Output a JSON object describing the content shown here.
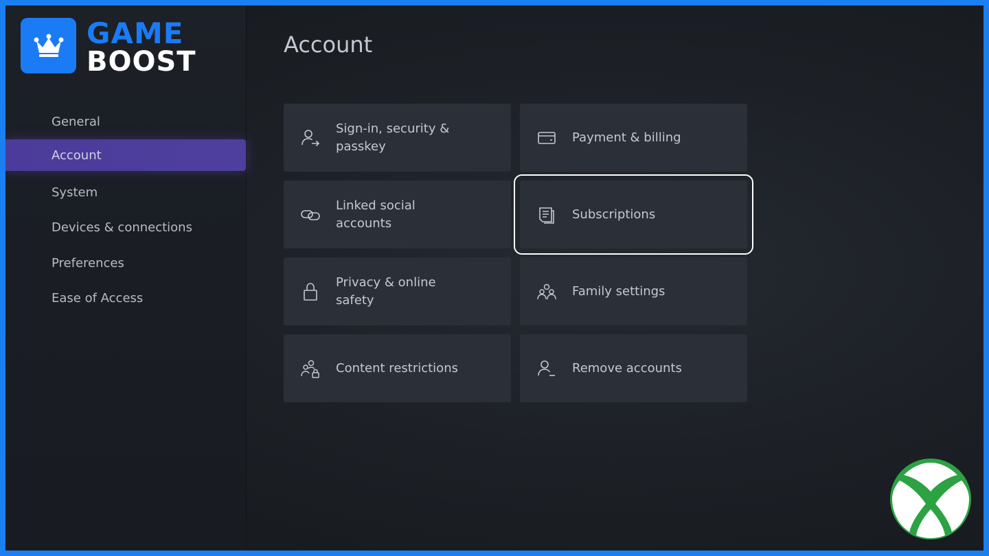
{
  "brand": {
    "logo_word1": "GAME",
    "logo_word2": "BOOST",
    "accent_color": "#1b7bf5"
  },
  "sidebar": {
    "items": [
      {
        "label": "General",
        "active": false
      },
      {
        "label": "Account",
        "active": true
      },
      {
        "label": "System",
        "active": false
      },
      {
        "label": "Devices & connections",
        "active": false
      },
      {
        "label": "Preferences",
        "active": false
      },
      {
        "label": "Ease of Access",
        "active": false
      }
    ],
    "active_color": "#4c3b9a"
  },
  "main": {
    "title": "Account",
    "tiles": [
      {
        "label": "Sign-in, security & passkey",
        "icon": "person-arrow-icon"
      },
      {
        "label": "Payment & billing",
        "icon": "credit-card-icon"
      },
      {
        "label": "Linked social accounts",
        "icon": "link-icon"
      },
      {
        "label": "Subscriptions",
        "icon": "document-list-icon",
        "focused": true
      },
      {
        "label": "Privacy & online safety",
        "icon": "lock-icon"
      },
      {
        "label": "Family settings",
        "icon": "family-icon"
      },
      {
        "label": "Content restrictions",
        "icon": "people-lock-icon"
      },
      {
        "label": "Remove accounts",
        "icon": "person-minus-icon"
      }
    ]
  },
  "xbox_logo": {
    "icon": "xbox-logo-icon",
    "color": "#2ca243"
  }
}
